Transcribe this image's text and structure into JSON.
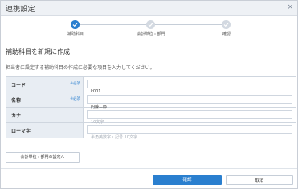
{
  "dialog": {
    "title": "連携設定",
    "close_label": "×"
  },
  "steps": [
    {
      "label": "補助科目",
      "status": "done"
    },
    {
      "label": "会計単位・部門",
      "status": "todo"
    },
    {
      "label": "確認",
      "status": "todo"
    }
  ],
  "section_title": "補助科目を新規に作成",
  "description": "担当者に設定する補助科目の作成に必要な項目を入力してください。",
  "form": {
    "rows": [
      {
        "label": "コード",
        "required": "※必須",
        "value": "k001",
        "placeholder": ""
      },
      {
        "label": "名称",
        "required": "※必須",
        "value": "円藤二郎",
        "placeholder": ""
      },
      {
        "label": "カナ",
        "required": "",
        "value": "",
        "placeholder": "10文字"
      },
      {
        "label": "ローマ字",
        "required": "",
        "value": "",
        "placeholder": "半角英数字・記号 10文字"
      }
    ]
  },
  "buttons": {
    "dept_settings": "会計単位・部門の設定へ",
    "confirm": "確認",
    "cancel": "取消"
  },
  "colors": {
    "accent": "#2a7fcf",
    "label_bg": "#e8edf3",
    "border": "#cfd6df"
  }
}
